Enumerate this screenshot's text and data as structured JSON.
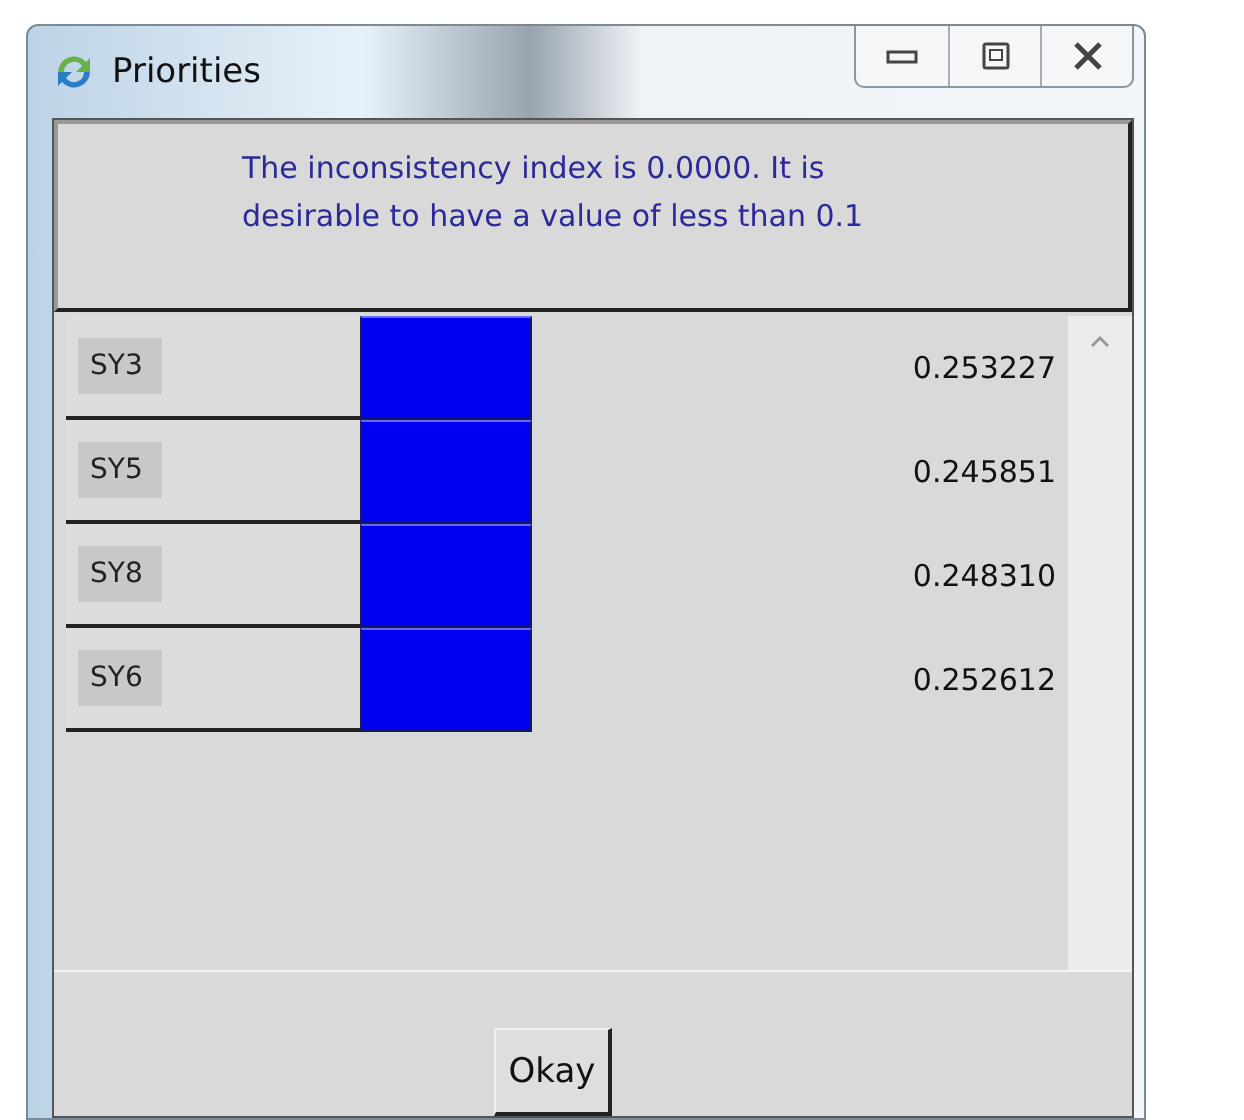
{
  "window": {
    "title": "Priorities"
  },
  "message": "The inconsistency index is 0.0000.  It is desirable to have a value of less than 0.1",
  "rows": [
    {
      "name": "SY3",
      "value": "0.253227"
    },
    {
      "name": "SY5",
      "value": "0.245851"
    },
    {
      "name": "SY8",
      "value": "0.248310"
    },
    {
      "name": "SY6",
      "value": "0.252612"
    }
  ],
  "buttons": [
    "Okay"
  ]
}
